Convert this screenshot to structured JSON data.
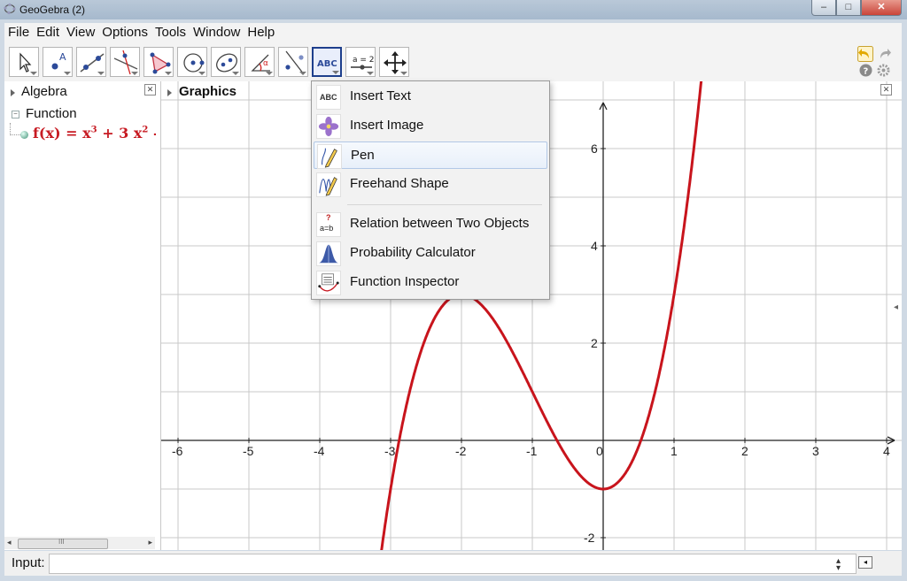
{
  "window": {
    "title": "GeoGebra (2)",
    "controls": {
      "minimize": "–",
      "maximize": "□",
      "close": "✕"
    }
  },
  "menubar": [
    "File",
    "Edit",
    "View",
    "Options",
    "Tools",
    "Window",
    "Help"
  ],
  "toolbar": {
    "tools": [
      {
        "name": "move-tool",
        "icon": "arrow-pointer-icon"
      },
      {
        "name": "point-tool",
        "icon": "point-icon"
      },
      {
        "name": "line-tool",
        "icon": "line-through-points-icon"
      },
      {
        "name": "perpendicular-tool",
        "icon": "perpendicular-line-icon"
      },
      {
        "name": "polygon-tool",
        "icon": "polygon-icon"
      },
      {
        "name": "circle-tool",
        "icon": "circle-center-point-icon"
      },
      {
        "name": "ellipse-tool",
        "icon": "ellipse-icon"
      },
      {
        "name": "angle-tool",
        "icon": "angle-icon"
      },
      {
        "name": "reflect-tool",
        "icon": "reflect-icon"
      },
      {
        "name": "text-tool",
        "icon": "text-abc-icon",
        "label": "ABC"
      },
      {
        "name": "slider-tool",
        "icon": "slider-icon",
        "label": "a = 2"
      },
      {
        "name": "move-graphics-tool",
        "icon": "move-graphics-icon"
      }
    ],
    "undo_icon": "undo-icon",
    "redo_icon": "redo-icon",
    "help_icon": "help-icon",
    "settings_icon": "gear-icon"
  },
  "algebra": {
    "title": "Algebra",
    "group": "Function",
    "definition_prefix": "f(x) = x",
    "definition_exp1": "3",
    "definition_mid": " + 3 x",
    "definition_exp2": "2",
    "definition_tail": " -",
    "scroll_mid": "III"
  },
  "graphics": {
    "title": "Graphics",
    "x_ticks": [
      "-6",
      "-5",
      "-4",
      "-3",
      "-2",
      "-1",
      "0",
      "1",
      "2",
      "3",
      "4"
    ],
    "y_ticks": [
      "-2",
      "2",
      "4",
      "6"
    ],
    "curve_color": "#c8141c"
  },
  "dropdown": {
    "items": [
      {
        "label": "Insert Text",
        "icon": "text-abc-icon",
        "icon_text": "ABC"
      },
      {
        "label": "Insert Image",
        "icon": "image-flower-icon"
      },
      {
        "label": "Pen",
        "icon": "pen-icon"
      },
      {
        "label": "Freehand Shape",
        "icon": "freehand-shape-icon"
      },
      {
        "label": "Relation between Two Objects",
        "icon": "relation-icon",
        "icon_text_top": "?",
        "icon_text_bottom": "a=b"
      },
      {
        "label": "Probability Calculator",
        "icon": "probability-curve-icon"
      },
      {
        "label": "Function Inspector",
        "icon": "function-inspector-icon"
      }
    ]
  },
  "input": {
    "label": "Input:",
    "value": ""
  }
}
